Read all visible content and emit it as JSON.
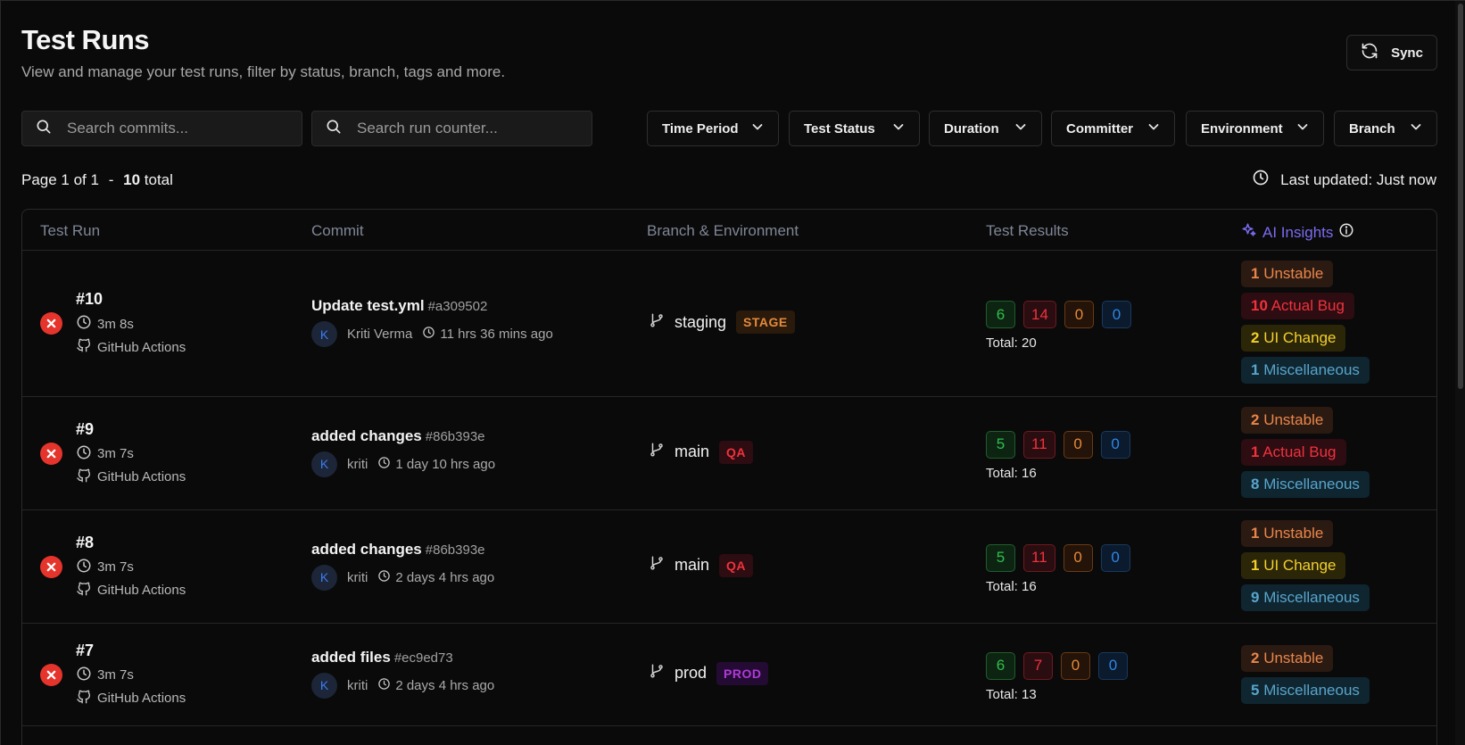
{
  "header": {
    "title": "Test Runs",
    "subtitle": "View and manage your test runs, filter by status, branch, tags and more.",
    "sync_label": "Sync"
  },
  "search": {
    "commits_placeholder": "Search commits...",
    "run_counter_placeholder": "Search run counter..."
  },
  "filters": [
    "Time Period",
    "Test Status",
    "Duration",
    "Committer",
    "Environment",
    "Branch"
  ],
  "pagination": {
    "page_text": "Page 1 of 1",
    "sep": "-",
    "total_count": "10",
    "total_label": "total"
  },
  "last_updated": "Last updated: Just now",
  "columns": {
    "run": "Test Run",
    "commit": "Commit",
    "branch": "Branch & Environment",
    "results": "Test Results",
    "ai": "AI Insights"
  },
  "colors": {
    "accent_ai": "#7a6cf0",
    "fail": "#e5342c",
    "pass": "#2fbf4a",
    "env_stage": "#e58a3a",
    "env_qa": "#f0323c",
    "env_prod": "#b03ad9"
  },
  "rows": [
    {
      "status": "failed",
      "run": "#10",
      "duration": "3m 8s",
      "source": "GitHub Actions",
      "commit_msg": "Update test.yml",
      "commit_hash": "#a309502",
      "author_initial": "K",
      "author": "Kriti Verma",
      "time_ago": "11 hrs 36 mins ago",
      "branch": "staging",
      "env": "STAGE",
      "env_type": "stage",
      "results": {
        "passed": "6",
        "failed": "14",
        "flaky": "0",
        "skipped": "0"
      },
      "total": "Total: 20",
      "insights": [
        {
          "count": "1",
          "label": "Unstable",
          "kind": "unstable"
        },
        {
          "count": "10",
          "label": "Actual Bug",
          "kind": "bug"
        },
        {
          "count": "2",
          "label": "UI Change",
          "kind": "ui"
        },
        {
          "count": "1",
          "label": "Miscellaneous",
          "kind": "misc"
        }
      ]
    },
    {
      "status": "failed",
      "run": "#9",
      "duration": "3m 7s",
      "source": "GitHub Actions",
      "commit_msg": "added changes",
      "commit_hash": "#86b393e",
      "author_initial": "K",
      "author": "kriti",
      "time_ago": "1 day 10 hrs ago",
      "branch": "main",
      "env": "QA",
      "env_type": "qa",
      "results": {
        "passed": "5",
        "failed": "11",
        "flaky": "0",
        "skipped": "0"
      },
      "total": "Total: 16",
      "insights": [
        {
          "count": "2",
          "label": "Unstable",
          "kind": "unstable"
        },
        {
          "count": "1",
          "label": "Actual Bug",
          "kind": "bug"
        },
        {
          "count": "8",
          "label": "Miscellaneous",
          "kind": "misc"
        }
      ]
    },
    {
      "status": "failed",
      "run": "#8",
      "duration": "3m 7s",
      "source": "GitHub Actions",
      "commit_msg": "added changes",
      "commit_hash": "#86b393e",
      "author_initial": "K",
      "author": "kriti",
      "time_ago": "2 days 4 hrs ago",
      "branch": "main",
      "env": "QA",
      "env_type": "qa",
      "results": {
        "passed": "5",
        "failed": "11",
        "flaky": "0",
        "skipped": "0"
      },
      "total": "Total: 16",
      "insights": [
        {
          "count": "1",
          "label": "Unstable",
          "kind": "unstable"
        },
        {
          "count": "1",
          "label": "UI Change",
          "kind": "ui"
        },
        {
          "count": "9",
          "label": "Miscellaneous",
          "kind": "misc"
        }
      ]
    },
    {
      "status": "failed",
      "run": "#7",
      "duration": "3m 7s",
      "source": "GitHub Actions",
      "commit_msg": "added files",
      "commit_hash": "#ec9ed73",
      "author_initial": "K",
      "author": "kriti",
      "time_ago": "2 days 4 hrs ago",
      "branch": "prod",
      "env": "PROD",
      "env_type": "prod",
      "results": {
        "passed": "6",
        "failed": "7",
        "flaky": "0",
        "skipped": "0"
      },
      "total": "Total: 13",
      "insights": [
        {
          "count": "2",
          "label": "Unstable",
          "kind": "unstable"
        },
        {
          "count": "5",
          "label": "Miscellaneous",
          "kind": "misc"
        }
      ]
    }
  ]
}
